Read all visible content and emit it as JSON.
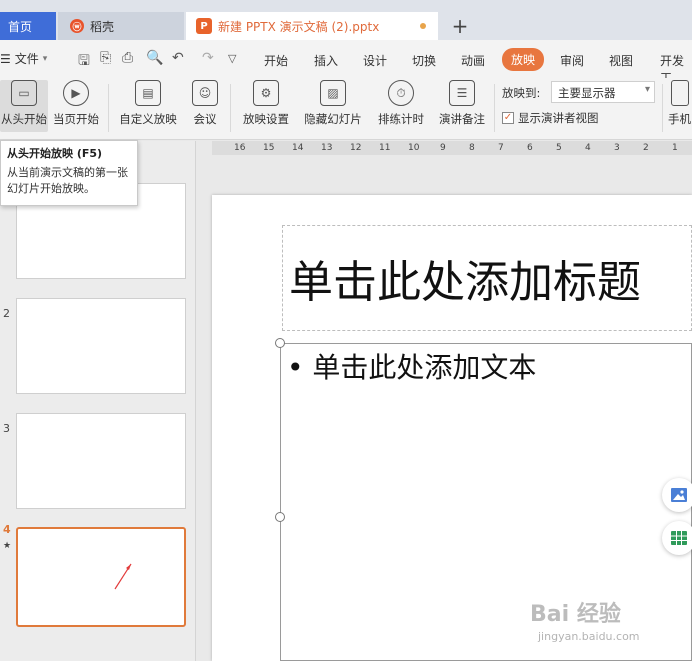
{
  "tabs": {
    "home": "首页",
    "docer": "稻壳",
    "document": "新建 PPTX 演示文稿 (2).pptx"
  },
  "menu": {
    "file": "文件",
    "tabs": [
      "开始",
      "插入",
      "设计",
      "切换",
      "动画",
      "放映",
      "审阅",
      "视图",
      "开发工"
    ]
  },
  "ribbon": {
    "from_start": "从头开始",
    "from_current": "当页开始",
    "custom_show": "自定义放映",
    "meeting": "会议",
    "show_settings": "放映设置",
    "hide_slide": "隐藏幻灯片",
    "rehearse": "排练计时",
    "speaker_notes": "演讲备注",
    "show_on_label": "放映到:",
    "display_value": "主要显示器",
    "presenter_view": "显示演讲者视图",
    "phone": "手机"
  },
  "tooltip": {
    "title": "从头开始放映 (F5)",
    "description": "从当前演示文稿的第一张幻灯片开始放映。"
  },
  "thumbnails": {
    "numbers": [
      "2",
      "3",
      "4"
    ]
  },
  "ruler": {
    "ticks": [
      "16",
      "15",
      "14",
      "13",
      "12",
      "11",
      "10",
      "9",
      "8",
      "7",
      "6",
      "5",
      "4",
      "3",
      "2",
      "1"
    ]
  },
  "slide": {
    "title_placeholder": "单击此处添加标题",
    "body_placeholder": "单击此处添加文本"
  },
  "watermark": {
    "brand": "Bai 经验",
    "url": "jingyan.baidu.com"
  },
  "colors": {
    "accent": "#e8763f",
    "home_tab": "#3f6dd8"
  }
}
